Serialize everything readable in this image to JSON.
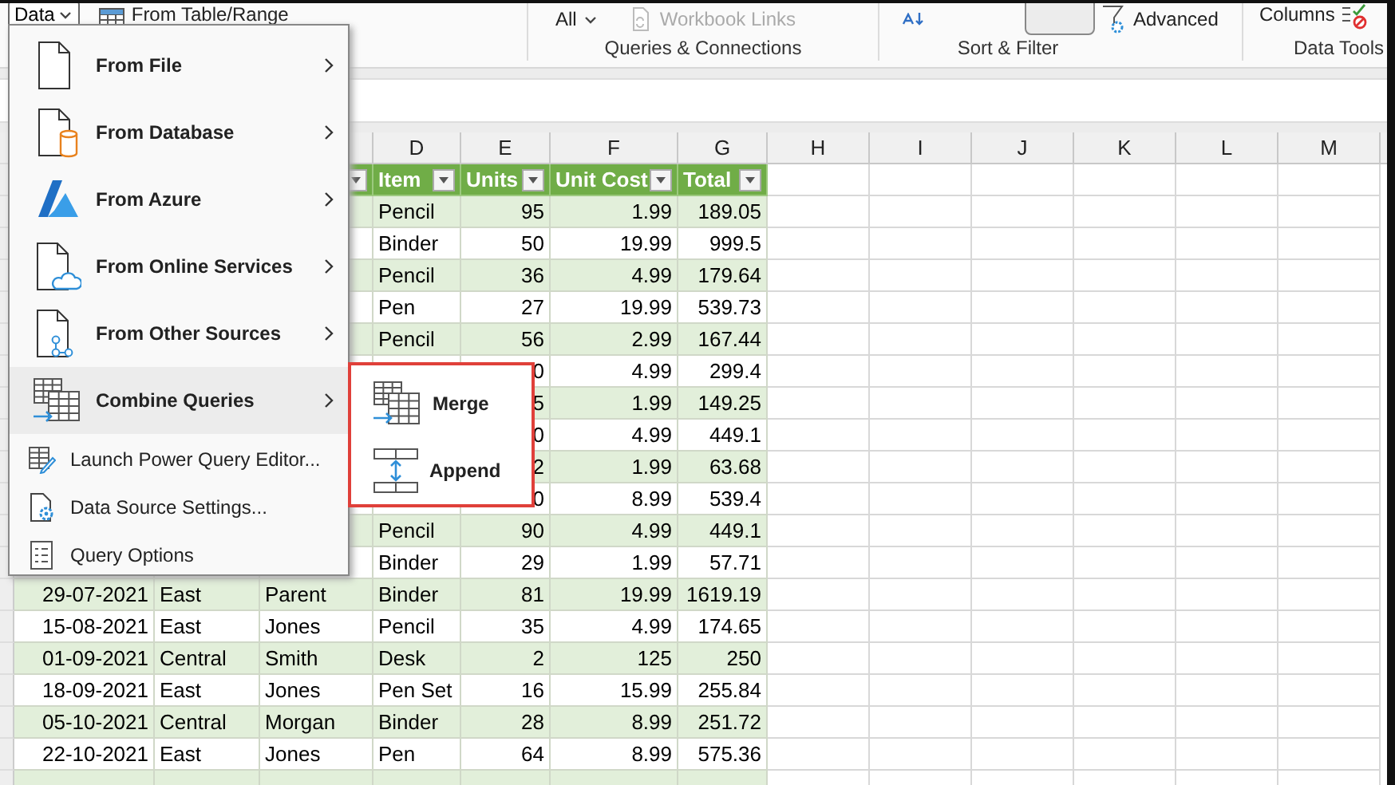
{
  "ribbon": {
    "data_button": "Data",
    "from_table": "From Table/Range",
    "refresh_all": "All",
    "workbook_links": {
      "label": "Workbook Links",
      "disabled": true
    },
    "filter_button": {
      "on": true
    },
    "advanced": "Advanced",
    "columns": "Columns",
    "groups": [
      "Queries & Connections",
      "Sort & Filter",
      "Data Tools"
    ]
  },
  "sheet": {
    "column_headers": [
      "D",
      "E",
      "F",
      "G",
      "H",
      "I",
      "J",
      "K",
      "L",
      "M"
    ],
    "table_headers": [
      "Item",
      "Units",
      "Unit Cost",
      "Total"
    ],
    "rows": [
      {
        "banded": true,
        "item": "Pencil",
        "units": "95",
        "unit_cost": "1.99",
        "total": "189.05"
      },
      {
        "banded": false,
        "item": "Binder",
        "units": "50",
        "unit_cost": "19.99",
        "total": "999.5"
      },
      {
        "banded": true,
        "item": "Pencil",
        "units": "36",
        "unit_cost": "4.99",
        "total": "179.64"
      },
      {
        "banded": false,
        "item": "Pen",
        "units": "27",
        "unit_cost": "19.99",
        "total": "539.73"
      },
      {
        "banded": true,
        "item": "Pencil",
        "units": "56",
        "unit_cost": "2.99",
        "total": "167.44"
      },
      {
        "banded": false,
        "units": "0",
        "unit_cost": "4.99",
        "total": "299.4"
      },
      {
        "banded": true,
        "units": "5",
        "unit_cost": "1.99",
        "total": "149.25"
      },
      {
        "banded": false,
        "units": "0",
        "unit_cost": "4.99",
        "total": "449.1"
      },
      {
        "banded": true,
        "units": "2",
        "unit_cost": "1.99",
        "total": "63.68"
      },
      {
        "banded": false,
        "units": "0",
        "unit_cost": "8.99",
        "total": "539.4"
      },
      {
        "banded": true,
        "item": "Pencil",
        "units": "90",
        "unit_cost": "4.99",
        "total": "449.1"
      },
      {
        "banded": false,
        "item": "Binder",
        "units": "29",
        "unit_cost": "1.99",
        "total": "57.71"
      },
      {
        "banded": true,
        "date": "29-07-2021",
        "region": "East",
        "rep": "Parent",
        "item": "Binder",
        "units": "81",
        "unit_cost": "19.99",
        "total": "1619.19"
      },
      {
        "banded": false,
        "date": "15-08-2021",
        "region": "East",
        "rep": "Jones",
        "item": "Pencil",
        "units": "35",
        "unit_cost": "4.99",
        "total": "174.65"
      },
      {
        "banded": true,
        "date": "01-09-2021",
        "region": "Central",
        "rep": "Smith",
        "item": "Desk",
        "units": "2",
        "unit_cost": "125",
        "total": "250"
      },
      {
        "banded": false,
        "date": "18-09-2021",
        "region": "East",
        "rep": "Jones",
        "item": "Pen Set",
        "units": "16",
        "unit_cost": "15.99",
        "total": "255.84"
      },
      {
        "banded": true,
        "date": "05-10-2021",
        "region": "Central",
        "rep": "Morgan",
        "item": "Binder",
        "units": "28",
        "unit_cost": "8.99",
        "total": "251.72"
      },
      {
        "banded": false,
        "date": "22-10-2021",
        "region": "East",
        "rep": "Jones",
        "item": "Pen",
        "units": "64",
        "unit_cost": "8.99",
        "total": "575.36"
      },
      {
        "banded": true
      }
    ]
  },
  "menu": {
    "items": [
      {
        "kind": "large",
        "label": "From File",
        "submenu": true,
        "selected": false
      },
      {
        "kind": "large",
        "label": "From Database",
        "submenu": true,
        "selected": false
      },
      {
        "kind": "large",
        "label": "From Azure",
        "submenu": true,
        "selected": false
      },
      {
        "kind": "large",
        "label": "From Online Services",
        "submenu": true,
        "selected": false
      },
      {
        "kind": "large",
        "label": "From Other Sources",
        "submenu": true,
        "selected": false
      },
      {
        "kind": "large",
        "label": "Combine Queries",
        "submenu": true,
        "selected": true
      },
      {
        "kind": "small",
        "label": "Launch Power Query Editor...",
        "submenu": false,
        "selected": false
      },
      {
        "kind": "small",
        "label": "Data Source Settings...",
        "submenu": false,
        "selected": false
      },
      {
        "kind": "small",
        "label": "Query Options",
        "submenu": false,
        "selected": false
      }
    ]
  },
  "submenu": {
    "items": [
      {
        "label": "Merge"
      },
      {
        "label": "Append"
      }
    ]
  }
}
